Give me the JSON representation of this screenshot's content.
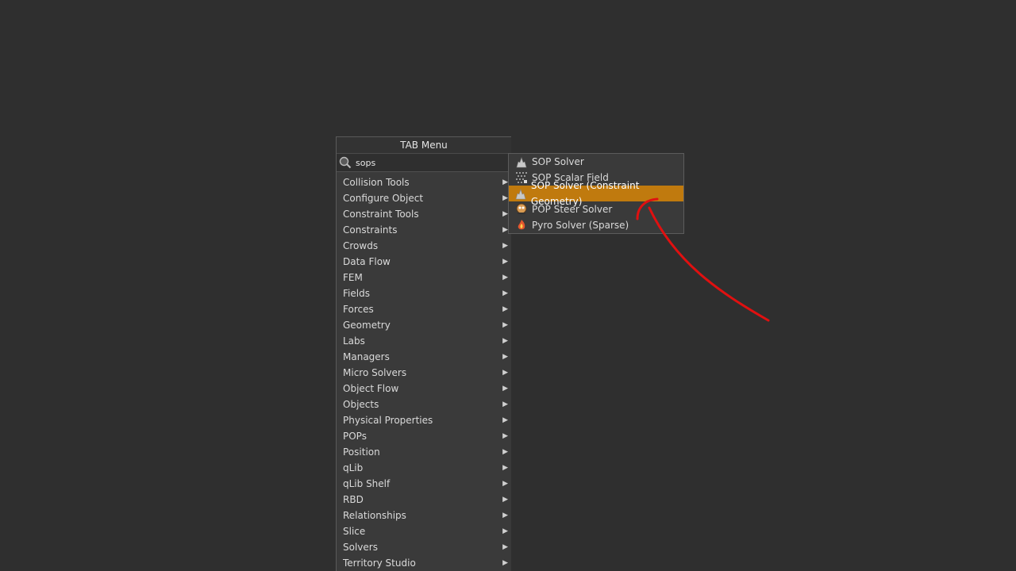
{
  "tab_menu": {
    "title": "TAB Menu",
    "search_value": "sops",
    "categories": [
      "Collision Tools",
      "Configure Object",
      "Constraint Tools",
      "Constraints",
      "Crowds",
      "Data Flow",
      "FEM",
      "Fields",
      "Forces",
      "Geometry",
      "Labs",
      "Managers",
      "Micro Solvers",
      "Object Flow",
      "Objects",
      "Physical Properties",
      "POPs",
      "Position",
      "qLib",
      "qLib Shelf",
      "RBD",
      "Relationships",
      "Slice",
      "Solvers",
      "Territory Studio"
    ],
    "arrow_glyph": "▶"
  },
  "submenu": {
    "items": [
      {
        "label": "SOP Solver",
        "icon": "sop-solver-icon"
      },
      {
        "label": "SOP Scalar Field",
        "icon": "scalar-field-icon"
      },
      {
        "label": "SOP Solver (Constraint Geometry)",
        "icon": "sop-solver-icon",
        "selected": true
      },
      {
        "label": "POP Steer Solver",
        "icon": "pop-steer-icon"
      },
      {
        "label": "Pyro Solver (Sparse)",
        "icon": "pyro-solver-icon"
      }
    ]
  },
  "colors": {
    "background": "#2f2f2f",
    "menu": "#3a3a3a",
    "highlight": "#c07a0e",
    "annotation_arrow": "#e01010"
  }
}
